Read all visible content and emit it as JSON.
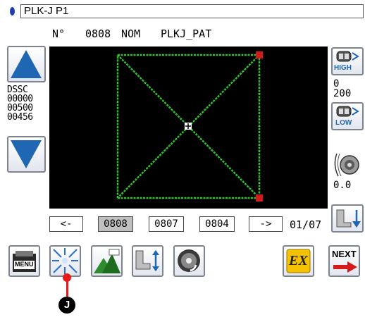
{
  "header": {
    "title": "PLK-J P1",
    "no_label": "N°",
    "no_value": "0808",
    "nom_label": "NOM",
    "nom_value": "PLKJ_PAT"
  },
  "left_panel": {
    "counter_label": "DSSC",
    "counters": [
      "00000",
      "00500",
      "00456"
    ]
  },
  "right_panel": {
    "speed_high_label": "HIGH",
    "speed_low_label": "LOW",
    "speed_values": [
      "0",
      "200"
    ],
    "thread_value": "0.0"
  },
  "page_row": {
    "prev_label": "<-",
    "next_label": "->",
    "patterns": [
      "0808",
      "0807",
      "0804"
    ],
    "selected_pattern": "0808",
    "page_indicator": "01/07"
  },
  "bottom_toolbar": {
    "menu_label": "MENU",
    "ex_label": "EX",
    "next_label": "NEXT"
  },
  "callout": {
    "marker": "J"
  },
  "colors": {
    "canvas_bg": "#000000",
    "pattern_line": "#2fc42b",
    "corner_marker": "#d41a1a",
    "arrow_blue": "#1f66b3",
    "callout_red": "#e8191b"
  }
}
